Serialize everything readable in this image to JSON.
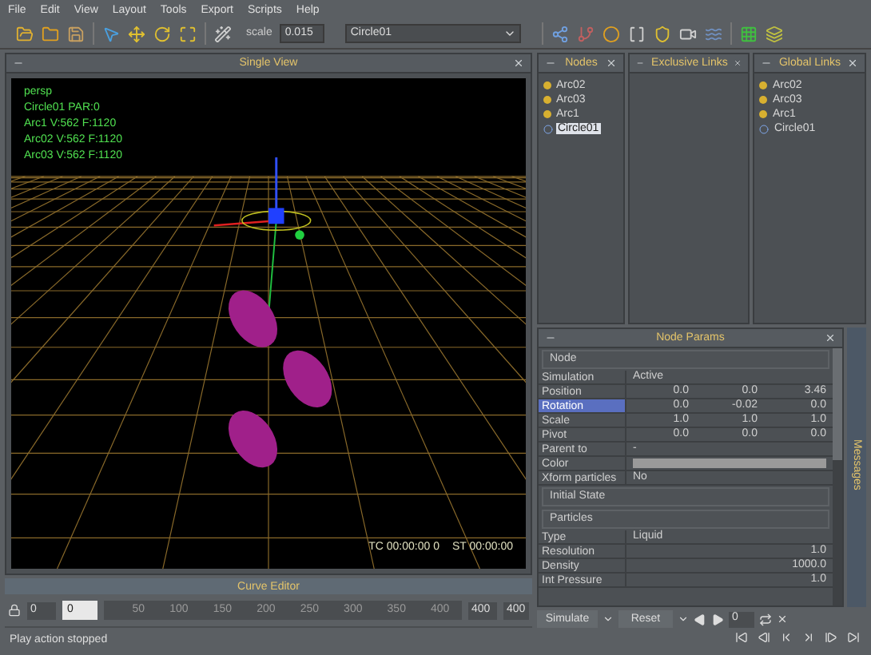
{
  "menu": [
    "File",
    "Edit",
    "View",
    "Layout",
    "Tools",
    "Export",
    "Scripts",
    "Help"
  ],
  "toolbar": {
    "scale_label": "scale",
    "scale_value": "0.015",
    "object": "Circle01"
  },
  "viewport": {
    "title": "Single View",
    "overlay": [
      "persp",
      "Circle01 PAR:0",
      "Arc1 V:562 F:1120",
      "Arc02 V:562 F:1120",
      "Arc03 V:562 F:1120"
    ],
    "timecode": "TC 00:00:00 0",
    "start_time": "ST 00:00:00"
  },
  "panels": [
    {
      "title": "Nodes",
      "items": [
        {
          "label": "Arc02",
          "kind": "arc",
          "selected": false
        },
        {
          "label": "Arc03",
          "kind": "arc",
          "selected": false
        },
        {
          "label": "Arc1",
          "kind": "arc",
          "selected": false
        },
        {
          "label": "Circle01",
          "kind": "circle",
          "selected": true
        }
      ]
    },
    {
      "title": "Exclusive Links"
    },
    {
      "title": "Global Links",
      "items": [
        {
          "label": "Arc02",
          "kind": "arc",
          "selected": false
        },
        {
          "label": "Arc03",
          "kind": "arc",
          "selected": false
        },
        {
          "label": "Arc1",
          "kind": "arc",
          "selected": false
        },
        {
          "label": "Circle01",
          "kind": "circle",
          "selected": false
        }
      ]
    }
  ],
  "params": {
    "title": "Node Params",
    "rows": [
      {
        "kind": "section",
        "label": "Node"
      },
      {
        "kind": "text",
        "label": "Simulation",
        "value": "Active",
        "selected": false
      },
      {
        "kind": "vector",
        "label": "Position",
        "values": [
          "0.0",
          "0.0",
          "3.46"
        ],
        "selected": false
      },
      {
        "kind": "vector",
        "label": "Rotation",
        "values": [
          "0.0",
          "-0.02",
          "0.0"
        ],
        "selected": true
      },
      {
        "kind": "vector",
        "label": "Scale",
        "values": [
          "1.0",
          "1.0",
          "1.0"
        ],
        "selected": false
      },
      {
        "kind": "vector",
        "label": "Pivot",
        "values": [
          "0.0",
          "0.0",
          "0.0"
        ],
        "selected": false
      },
      {
        "kind": "text",
        "label": "Parent to",
        "value": "-",
        "selected": false
      },
      {
        "kind": "color",
        "label": "Color",
        "selected": false
      },
      {
        "kind": "text",
        "label": "Xform particles",
        "value": "No",
        "selected": false
      },
      {
        "kind": "section",
        "label": "Initial State"
      },
      {
        "kind": "section",
        "label": "Particles"
      },
      {
        "kind": "text",
        "label": "Type",
        "value": "Liquid",
        "selected": false
      },
      {
        "kind": "number",
        "label": "Resolution",
        "value": "1.0",
        "selected": false
      },
      {
        "kind": "number",
        "label": "Density",
        "value": "1000.0",
        "selected": false
      },
      {
        "kind": "number",
        "label": "Int Pressure",
        "value": "1.0",
        "selected": false
      }
    ]
  },
  "messages_tab": "Messages",
  "curve_editor": {
    "title": "Curve Editor"
  },
  "timeline": {
    "start": "0",
    "current": "0",
    "ticks": [
      "50",
      "100",
      "150",
      "200",
      "250",
      "300",
      "350",
      "400"
    ],
    "end": "400",
    "end_total": "400"
  },
  "controls": {
    "simulate": "Simulate",
    "reset": "Reset",
    "frame": "0"
  },
  "status": "Play action stopped"
}
